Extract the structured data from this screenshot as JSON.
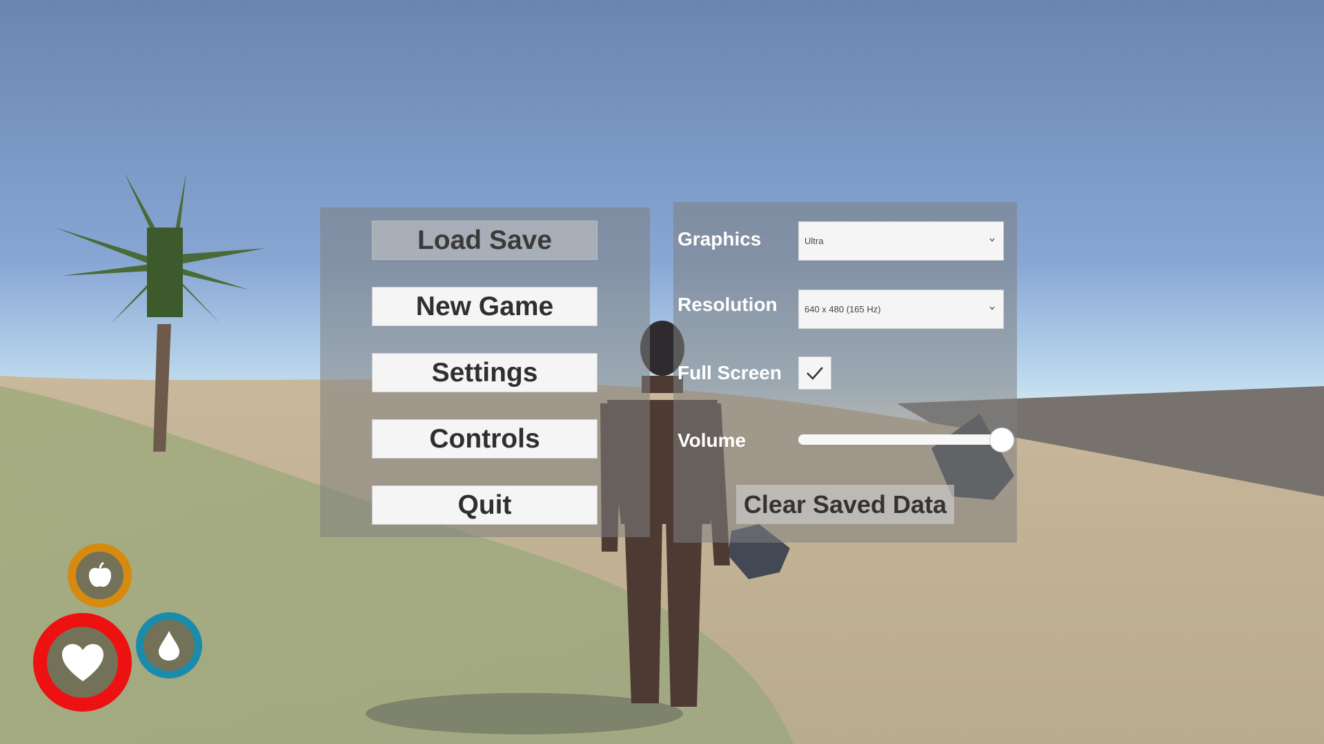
{
  "main_menu": {
    "buttons": [
      {
        "label": "Load Save",
        "enabled": false
      },
      {
        "label": "New Game",
        "enabled": true
      },
      {
        "label": "Settings",
        "enabled": true
      },
      {
        "label": "Controls",
        "enabled": true
      },
      {
        "label": "Quit",
        "enabled": true
      }
    ]
  },
  "settings": {
    "graphics": {
      "label": "Graphics",
      "value": "Ultra"
    },
    "resolution": {
      "label": "Resolution",
      "value": "640 x 480 (165 Hz)"
    },
    "fullscreen": {
      "label": "Full Screen",
      "checked": true
    },
    "volume": {
      "label": "Volume",
      "level": 1.0
    },
    "clear_button": "Clear Saved Data"
  },
  "hud": {
    "health_icon": "heart-icon",
    "hunger_icon": "apple-icon",
    "thirst_icon": "water-drop-icon",
    "health_color": "#ee1111",
    "hunger_color": "#d68a0f",
    "thirst_color": "#1a8bab"
  }
}
